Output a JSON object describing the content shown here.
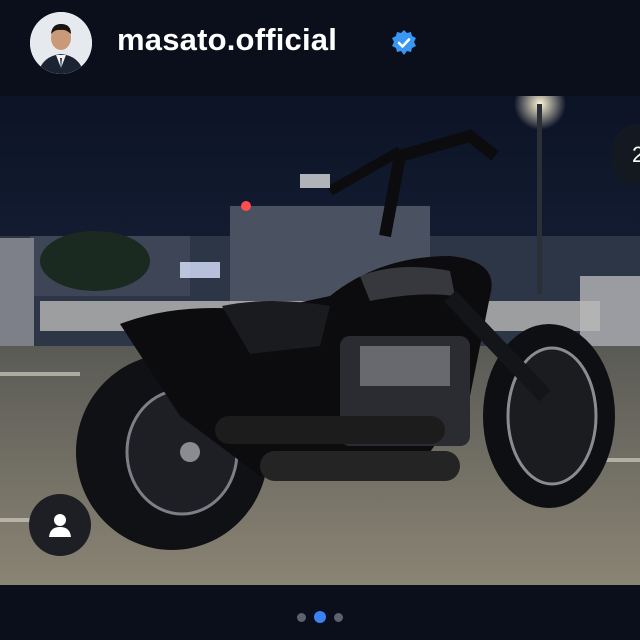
{
  "header": {
    "username": "masato.official",
    "verified": true,
    "avatar_icon": "profile-photo-man-in-suit"
  },
  "post": {
    "image_description_icon": "black-custom-motorcycle-photo",
    "carousel_count_visible": "2",
    "tag_icon": "person-tag-icon"
  },
  "carousel": {
    "total": 3,
    "active_index": 1
  },
  "colors": {
    "background": "#0b0f1c",
    "accent": "#3b82f6",
    "verified_badge": "#3897f0"
  }
}
